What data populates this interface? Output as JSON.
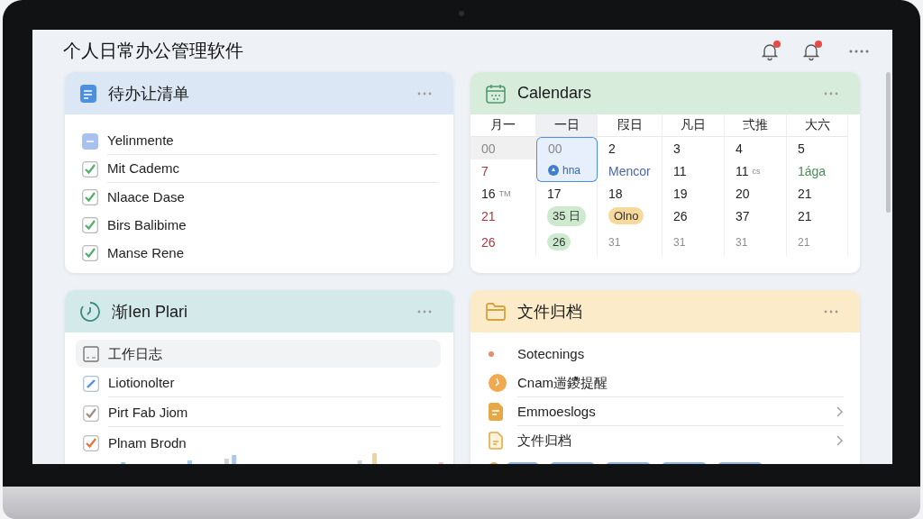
{
  "app": {
    "title": "个人日常办公管理软件",
    "notifications": [
      {
        "badge": true
      },
      {
        "badge": true
      }
    ]
  },
  "todo": {
    "title": "待办让清单",
    "items": [
      {
        "label": "Yelinmente",
        "kind": "partial",
        "checked": false,
        "divider": true
      },
      {
        "label": "Mit Cademc",
        "kind": "check",
        "checked": true,
        "divider": true
      },
      {
        "label": "Nlaace Dase",
        "kind": "check",
        "checked": true,
        "divider": false
      },
      {
        "label": "Birs Balibime",
        "kind": "check",
        "checked": true,
        "divider": false
      },
      {
        "label": "Manse Rene",
        "kind": "check",
        "checked": true,
        "divider": false
      }
    ]
  },
  "calendar": {
    "title": "Calendars",
    "weekdays": [
      {
        "label": "月一",
        "selected": false
      },
      {
        "label": "一日",
        "selected": true
      },
      {
        "label": "叚日",
        "selected": false
      },
      {
        "label": "凡日",
        "selected": false
      },
      {
        "label": "弍推",
        "selected": false
      },
      {
        "label": "大六",
        "selected": false
      }
    ],
    "rows": [
      [
        {
          "text": "00",
          "kind": "dim",
          "selected": false
        },
        {
          "text": "00",
          "kind": "muted",
          "selected": true
        },
        {
          "text": "2",
          "selected": false
        },
        {
          "text": "3",
          "selected": false
        },
        {
          "text": "4",
          "selected": false
        },
        {
          "text": "5",
          "selected": false
        }
      ],
      [
        {
          "text": "7",
          "kind": "red",
          "selected": false
        },
        {
          "text": "hna",
          "kind": "event",
          "selected": true
        },
        {
          "text": "Mencor",
          "kind": "blue",
          "selected": false
        },
        {
          "text": "11",
          "selected": false
        },
        {
          "text": "11",
          "note": "cs",
          "selected": false
        },
        {
          "text": "1ága",
          "kind": "green",
          "selected": false
        }
      ],
      [
        {
          "text": "16",
          "note": "TM",
          "selected": false
        },
        {
          "text": "17",
          "selected": false
        },
        {
          "text": "18",
          "selected": false
        },
        {
          "text": "19",
          "selected": false
        },
        {
          "text": "20",
          "selected": false
        },
        {
          "text": "21",
          "selected": false
        }
      ],
      [
        {
          "text": "21",
          "kind": "red",
          "selected": false
        },
        {
          "text": "35 日",
          "kind": "pill",
          "color": "#cdeacf",
          "selected": false
        },
        {
          "text": "Olno",
          "kind": "pill",
          "color": "#f7d99b",
          "selected": false
        },
        {
          "text": "26",
          "selected": false
        },
        {
          "text": "37",
          "selected": false
        },
        {
          "text": "21",
          "selected": false
        }
      ],
      [
        {
          "text": "26",
          "kind": "red",
          "selected": false
        },
        {
          "text": "26",
          "kind": "pill",
          "color": "#cdeacf",
          "selected": false
        },
        {
          "text": "31",
          "kind": "gray",
          "selected": false
        },
        {
          "text": "31",
          "kind": "gray",
          "selected": false
        },
        {
          "text": "31",
          "kind": "gray",
          "selected": false
        },
        {
          "text": "21",
          "kind": "gray",
          "selected": false
        }
      ]
    ]
  },
  "plan": {
    "title": "渐Ien Plari",
    "items": [
      {
        "label": "工作日志",
        "kind": "log",
        "selected": true,
        "divider": false
      },
      {
        "label": "Liotionolter",
        "kind": "edit",
        "selected": false,
        "divider": true
      },
      {
        "label": "Pirt Fab Jiom",
        "kind": "check",
        "color": "#a08c86",
        "selected": false,
        "divider": true
      },
      {
        "label": "Plnam Brodn",
        "kind": "check",
        "color": "#e8733a",
        "selected": false,
        "divider": false
      }
    ]
  },
  "files": {
    "title": "文件归档",
    "items": [
      {
        "label": "Sotecnings",
        "kind": "dot",
        "chevron": false,
        "divider": false
      },
      {
        "label": "Cnam遄鑁提醒",
        "kind": "clock",
        "chevron": false,
        "divider": true
      },
      {
        "label": "Emmoeslogs",
        "kind": "doc",
        "chevron": true,
        "divider": true
      },
      {
        "label": "文件归档",
        "kind": "file",
        "chevron": true,
        "divider": false
      }
    ]
  }
}
